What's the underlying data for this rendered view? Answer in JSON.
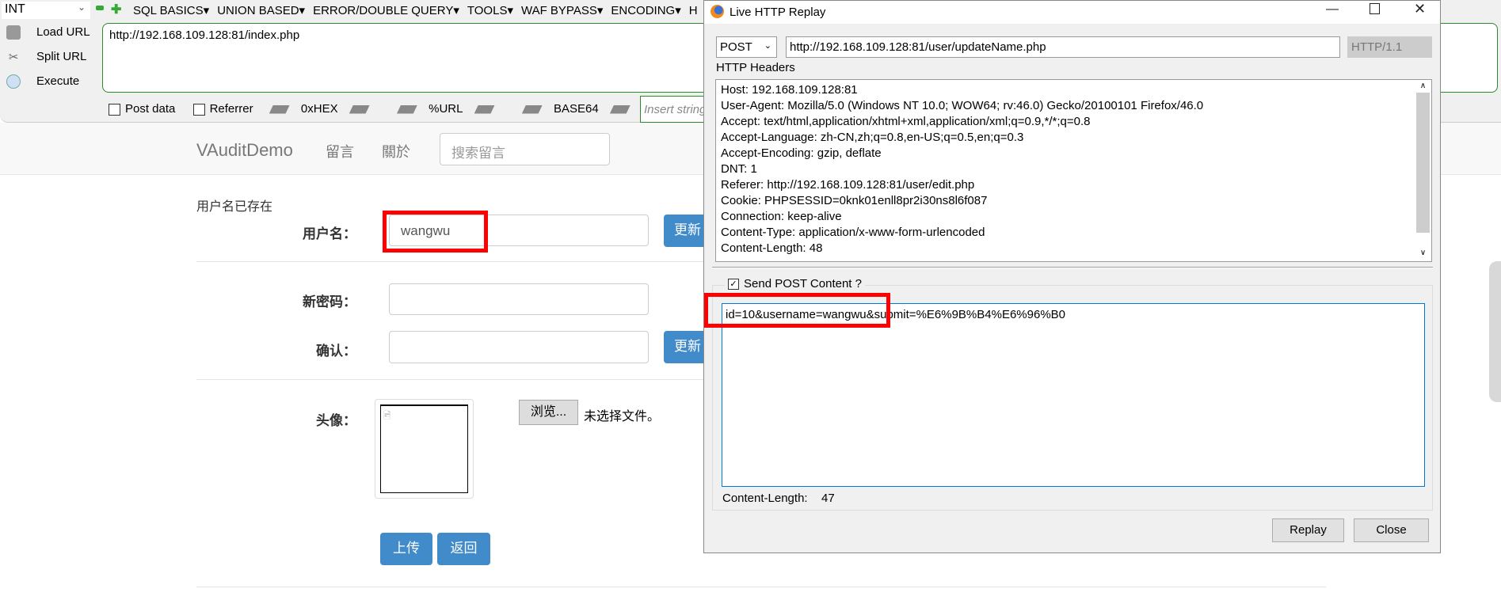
{
  "toolbar": {
    "select_value": "INT",
    "menus": [
      "SQL BASICS▾",
      "UNION BASED▾",
      "ERROR/DOUBLE QUERY▾",
      "TOOLS▾",
      "WAF BYPASS▾",
      "ENCODING▾",
      "H"
    ],
    "load_url": "Load URL",
    "split_url": "Split URL",
    "execute": "Execute",
    "url": "http://192.168.109.128:81/index.php",
    "post_data": "Post data",
    "referrer": "Referrer",
    "hex": "0xHEX",
    "urlenc": "%URL",
    "base64": "BASE64",
    "insert_placeholder": "Insert string"
  },
  "page": {
    "brand": "VAuditDemo",
    "nav": [
      "留言",
      "關於"
    ],
    "search_placeholder": "搜索留言",
    "error": "用户名已存在",
    "username_label": "用户名：",
    "username_value": "wangwu",
    "update_button": "更新",
    "new_password_label": "新密码：",
    "confirm_label": "确认：",
    "avatar_label": "头像：",
    "browse_button": "浏览...",
    "no_file": "未选择文件。",
    "upload_button": "上传",
    "back_button": "返回"
  },
  "dialog": {
    "title": "Live HTTP Replay",
    "method": "POST",
    "url": "http://192.168.109.128:81/user/updateName.php",
    "version": "HTTP/1.1",
    "headers_label": "HTTP Headers",
    "headers": [
      "Host: 192.168.109.128:81",
      "User-Agent: Mozilla/5.0 (Windows NT 10.0; WOW64; rv:46.0) Gecko/20100101 Firefox/46.0",
      "Accept: text/html,application/xhtml+xml,application/xml;q=0.9,*/*;q=0.8",
      "Accept-Language: zh-CN,zh;q=0.8,en-US;q=0.5,en;q=0.3",
      "Accept-Encoding: gzip, deflate",
      "DNT: 1",
      "Referer: http://192.168.109.128:81/user/edit.php",
      "Cookie: PHPSESSID=0knk01enll8pr2i30ns8l6f087",
      "Connection: keep-alive",
      "Content-Type: application/x-www-form-urlencoded",
      "Content-Length: 48"
    ],
    "send_post_label": "Send POST Content ?",
    "post_body": "id=10&username=wangwu&submit=%E6%9B%B4%E6%96%B0",
    "content_length_label": "Content-Length:",
    "content_length": "47",
    "replay": "Replay",
    "close": "Close"
  },
  "colors": {
    "accent": "#428bca",
    "highlight": "#ff0000",
    "url_border": "#2a8a2a"
  }
}
